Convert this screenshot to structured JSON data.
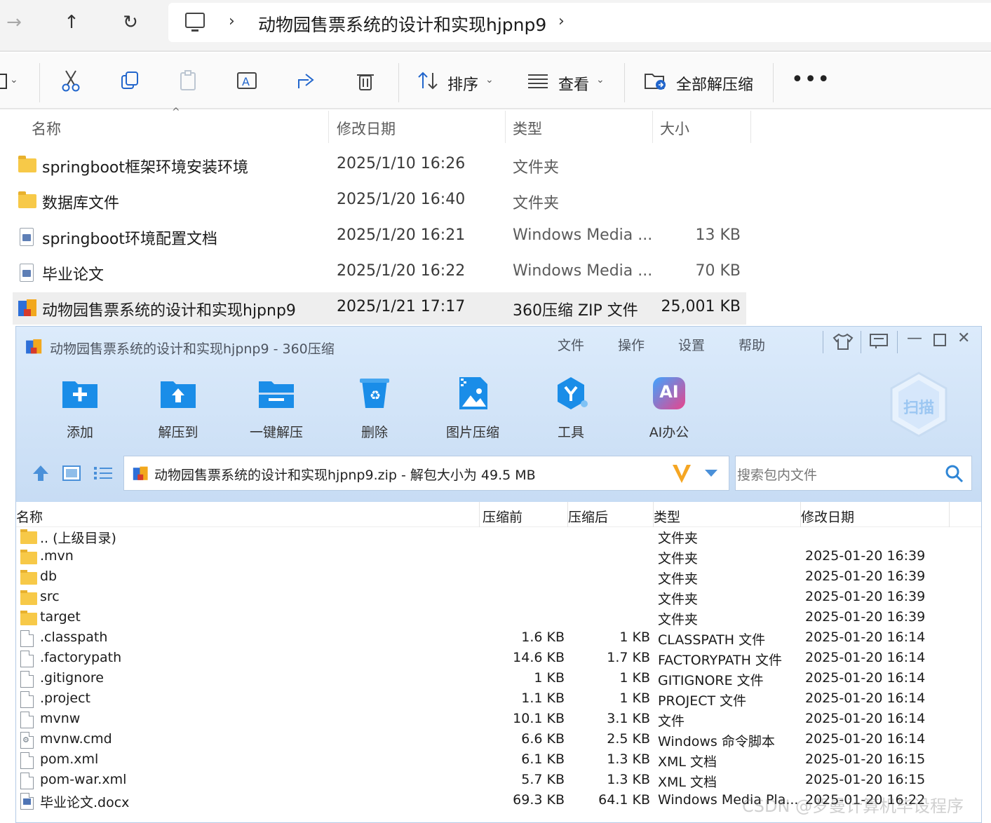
{
  "explorer": {
    "path_current": "动物园售票系统的设计和实现hjpnp9",
    "toolbar": {
      "sort_label": "排序",
      "view_label": "查看",
      "extract_all_label": "全部解压缩"
    },
    "columns": {
      "name": "名称",
      "modified": "修改日期",
      "type": "类型",
      "size": "大小"
    },
    "files": [
      {
        "name": "springboot框架环境安装环境",
        "date": "2025/1/10 16:26",
        "type": "文件夹",
        "size": "",
        "icon": "folder-icon"
      },
      {
        "name": "数据库文件",
        "date": "2025/1/20 16:40",
        "type": "文件夹",
        "size": "",
        "icon": "folder-icon"
      },
      {
        "name": "springboot环境配置文档",
        "date": "2025/1/20 16:21",
        "type": "Windows Media ...",
        "size": "13 KB",
        "icon": "media-file-icon"
      },
      {
        "name": "毕业论文",
        "date": "2025/1/20 16:22",
        "type": "Windows Media ...",
        "size": "70 KB",
        "icon": "media-file-icon"
      },
      {
        "name": "动物园售票系统的设计和实现hjpnp9",
        "date": "2025/1/21 17:17",
        "type": "360压缩 ZIP 文件",
        "size": "25,001 KB",
        "icon": "zip-icon",
        "selected": true
      }
    ]
  },
  "zip_window": {
    "title": "动物园售票系统的设计和实现hjpnp9 - 360压缩",
    "menu": [
      "文件",
      "操作",
      "设置",
      "帮助"
    ],
    "tools": [
      {
        "label": "添加",
        "icon": "add-folder-icon"
      },
      {
        "label": "解压到",
        "icon": "extract-to-icon"
      },
      {
        "label": "一键解压",
        "icon": "one-click-extract-icon"
      },
      {
        "label": "删除",
        "icon": "recycle-bin-icon"
      },
      {
        "label": "图片压缩",
        "icon": "image-compress-icon"
      },
      {
        "label": "工具",
        "icon": "tools-icon"
      },
      {
        "label": "AI办公",
        "icon": "ai-office-icon"
      }
    ],
    "scan_label": "扫描",
    "ai_badge_text": "AI",
    "address": "动物园售票系统的设计和实现hjpnp9.zip - 解包大小为 49.5 MB",
    "search_placeholder": "搜索包内文件",
    "columns": {
      "name": "名称",
      "before": "压缩前",
      "after": "压缩后",
      "type": "类型",
      "modified": "修改日期"
    },
    "rows": [
      {
        "name": ".. (上级目录)",
        "before": "",
        "after": "",
        "type": "文件夹",
        "date": "",
        "icon": "folder"
      },
      {
        "name": ".mvn",
        "before": "",
        "after": "",
        "type": "文件夹",
        "date": "2025-01-20 16:39",
        "icon": "folder"
      },
      {
        "name": "db",
        "before": "",
        "after": "",
        "type": "文件夹",
        "date": "2025-01-20 16:39",
        "icon": "folder"
      },
      {
        "name": "src",
        "before": "",
        "after": "",
        "type": "文件夹",
        "date": "2025-01-20 16:39",
        "icon": "folder"
      },
      {
        "name": "target",
        "before": "",
        "after": "",
        "type": "文件夹",
        "date": "2025-01-20 16:39",
        "icon": "folder"
      },
      {
        "name": ".classpath",
        "before": "1.6 KB",
        "after": "1 KB",
        "type": "CLASSPATH 文件",
        "date": "2025-01-20 16:14",
        "icon": "file"
      },
      {
        "name": ".factorypath",
        "before": "14.6 KB",
        "after": "1.7 KB",
        "type": "FACTORYPATH 文件",
        "date": "2025-01-20 16:14",
        "icon": "file"
      },
      {
        "name": ".gitignore",
        "before": "1 KB",
        "after": "1 KB",
        "type": "GITIGNORE 文件",
        "date": "2025-01-20 16:14",
        "icon": "file"
      },
      {
        "name": ".project",
        "before": "1.1 KB",
        "after": "1 KB",
        "type": "PROJECT 文件",
        "date": "2025-01-20 16:14",
        "icon": "file"
      },
      {
        "name": "mvnw",
        "before": "10.1 KB",
        "after": "3.1 KB",
        "type": "文件",
        "date": "2025-01-20 16:14",
        "icon": "file"
      },
      {
        "name": "mvnw.cmd",
        "before": "6.6 KB",
        "after": "2.5 KB",
        "type": "Windows 命令脚本",
        "date": "2025-01-20 16:14",
        "icon": "cmd"
      },
      {
        "name": "pom.xml",
        "before": "6.1 KB",
        "after": "1.3 KB",
        "type": "XML 文档",
        "date": "2025-01-20 16:15",
        "icon": "file"
      },
      {
        "name": "pom-war.xml",
        "before": "5.7 KB",
        "after": "1.3 KB",
        "type": "XML 文档",
        "date": "2025-01-20 16:15",
        "icon": "file"
      },
      {
        "name": "毕业论文.docx",
        "before": "69.3 KB",
        "after": "64.1 KB",
        "type": "Windows Media Pla...",
        "date": "2025-01-20 16:22",
        "icon": "wmp"
      }
    ]
  },
  "watermark": "CSDN @罗曼计算机毕设程序",
  "colors": {
    "zip_header_top": "#dcebfb",
    "zip_header_bottom": "#c7dcf4",
    "tool_blue": "#1a8de8",
    "ai_pink": "#e8448c"
  }
}
